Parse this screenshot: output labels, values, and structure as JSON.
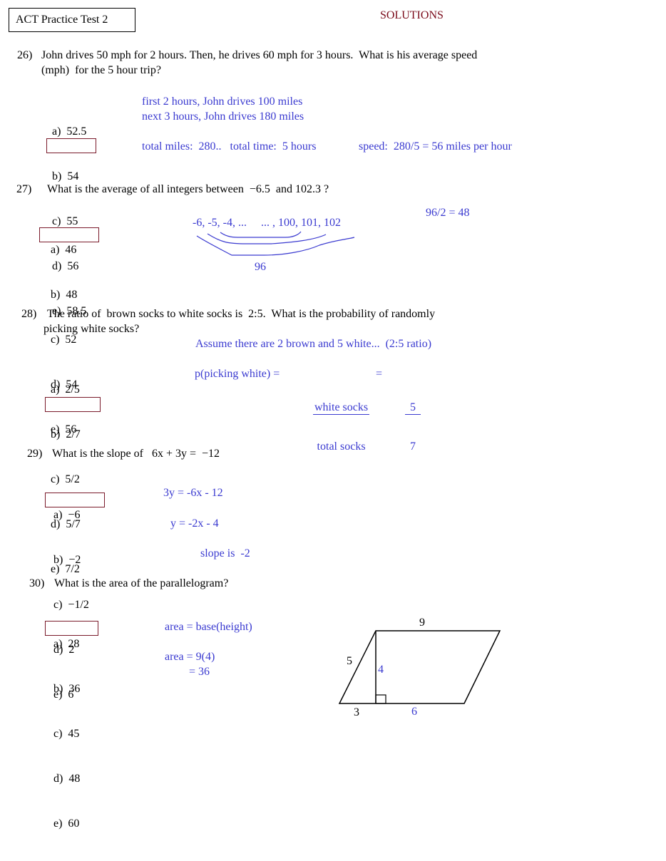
{
  "header": {
    "title": "ACT Practice Test 2",
    "label": "SOLUTIONS"
  },
  "colors": {
    "solution_text": "#3a3ad0",
    "answer_box": "#7a1a2a",
    "solutions_label": "#7a0a1a"
  },
  "questions": [
    {
      "number": "26)",
      "text_line1": "John drives 50 mph for 2 hours. Then, he drives 60 mph for 3 hours.  What is his average speed",
      "text_line2": "(mph)  for the 5 hour trip?",
      "choices": [
        "a)  52.5",
        "b)  54",
        "c)  55",
        "d)  56",
        "e)  58.5"
      ],
      "correct": "d",
      "solution": {
        "line1": "first 2 hours, John drives 100 miles",
        "line2": "next 3 hours, John drives 180 miles",
        "line3a": "total miles:  280..   total time:  5 hours",
        "line3b": "speed:  280/5 = 56 miles per hour"
      }
    },
    {
      "number": "27)",
      "text": "What is the average of all integers between  −6.5  and 102.3 ?",
      "choices": [
        "a)  46",
        "b)  48",
        "c)  52",
        "d)  54",
        "e)  56"
      ],
      "correct": "b",
      "solution": {
        "sequence": "-6, -5, -4, ...     ... , 100, 101, 102",
        "pair_sum": "96",
        "result": "96/2 = 48"
      }
    },
    {
      "number": "28)",
      "text_line1": "The ratio of  brown socks to white socks is  2:5.  What is the probability of randomly",
      "text_line2": "picking white socks?",
      "choices": [
        "a)  2/5",
        "b)  2/7",
        "c)  5/2",
        "d)  5/7",
        "e)  7/2"
      ],
      "correct": "d",
      "solution": {
        "assumption": "Assume there are 2 brown and 5 white...  (2:5 ratio)",
        "lhs": "p(picking white) =",
        "frac1_num": "white socks",
        "frac1_den": "total socks",
        "equals": "=",
        "frac2_num": "5",
        "frac2_den": "7"
      }
    },
    {
      "number": "29)",
      "text": "What is the slope of   6x + 3y =  −12",
      "choices": [
        "a)  −6",
        "b)  −2",
        "c)  −1/2",
        "d)  2",
        "e)  6"
      ],
      "correct": "b",
      "solution": {
        "step1": "3y = -6x - 12",
        "step2": "y = -2x - 4",
        "step3": "slope is  -2"
      }
    },
    {
      "number": "30)",
      "text": "What is the area of the parallelogram?",
      "choices": [
        "a)  28",
        "b)  36",
        "c)  45",
        "d)  48",
        "e)  60"
      ],
      "correct": "b",
      "solution": {
        "formula": "area = base(height)",
        "step1": "area = 9(4)",
        "step2": "= 36"
      },
      "figure": {
        "top_label": "9",
        "side_label": "5",
        "height_label": "4",
        "base_left_label": "3",
        "base_right_label": "6"
      }
    }
  ]
}
